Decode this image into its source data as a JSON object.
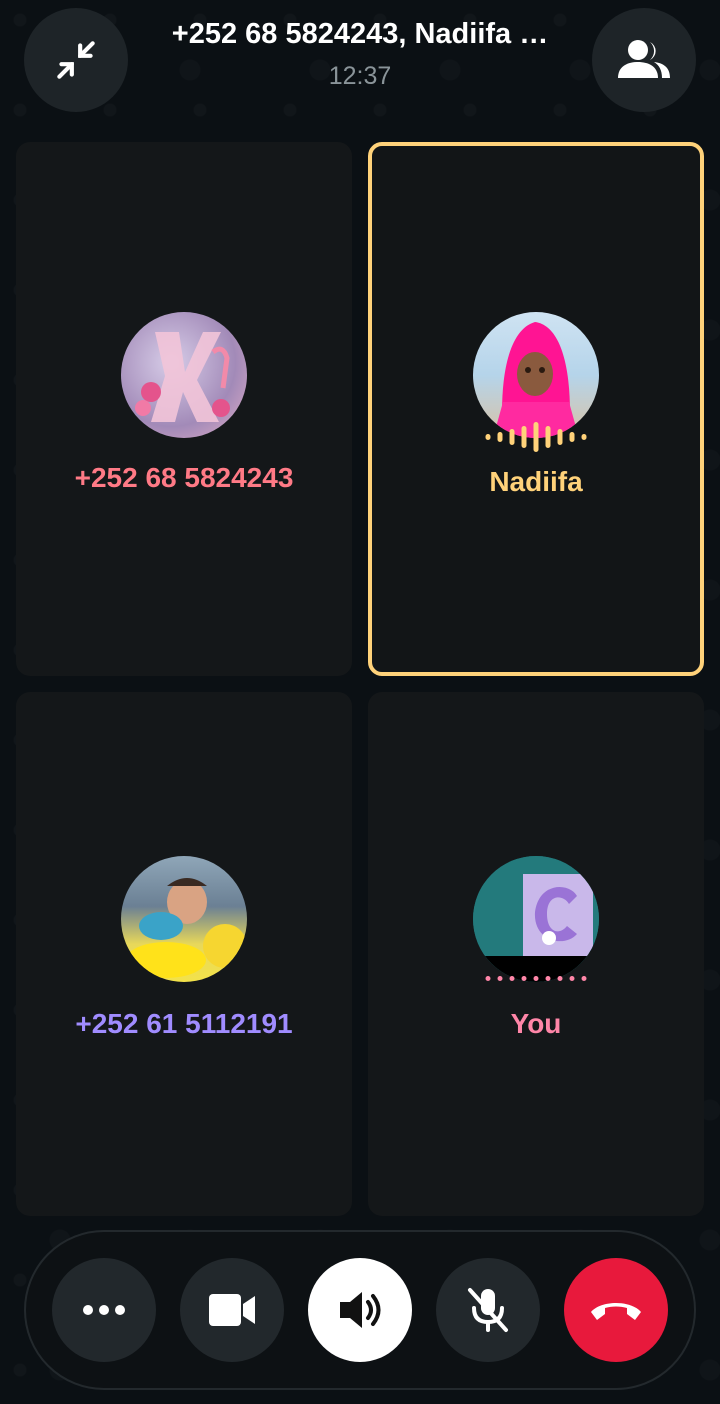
{
  "header": {
    "title": "+252 68 5824243, Nadiifa …",
    "time": "12:37",
    "minimize_icon": "minimize-arrows-icon",
    "participants_icon": "people-icon"
  },
  "participants": [
    {
      "name": "+252 68 5824243",
      "color": "#ff7a86",
      "avatar": "avatar-letter-k-flamingo"
    },
    {
      "name": "Nadiifa",
      "color": "#ffd27a",
      "avatar": "avatar-girl-pink-hijab",
      "speaking": true
    },
    {
      "name": "+252 61 5112191",
      "color": "#a08cff",
      "avatar": "avatar-baby"
    },
    {
      "name": "You",
      "color": "#ff86a8",
      "avatar": "avatar-letter-c-purple"
    }
  ],
  "controls": {
    "more_icon": "more-horizontal-icon",
    "video_icon": "video-camera-icon",
    "speaker_icon": "speaker-icon",
    "mute_icon": "microphone-off-icon",
    "end_call_icon": "end-call-icon",
    "end_call_color": "#e8193c"
  }
}
